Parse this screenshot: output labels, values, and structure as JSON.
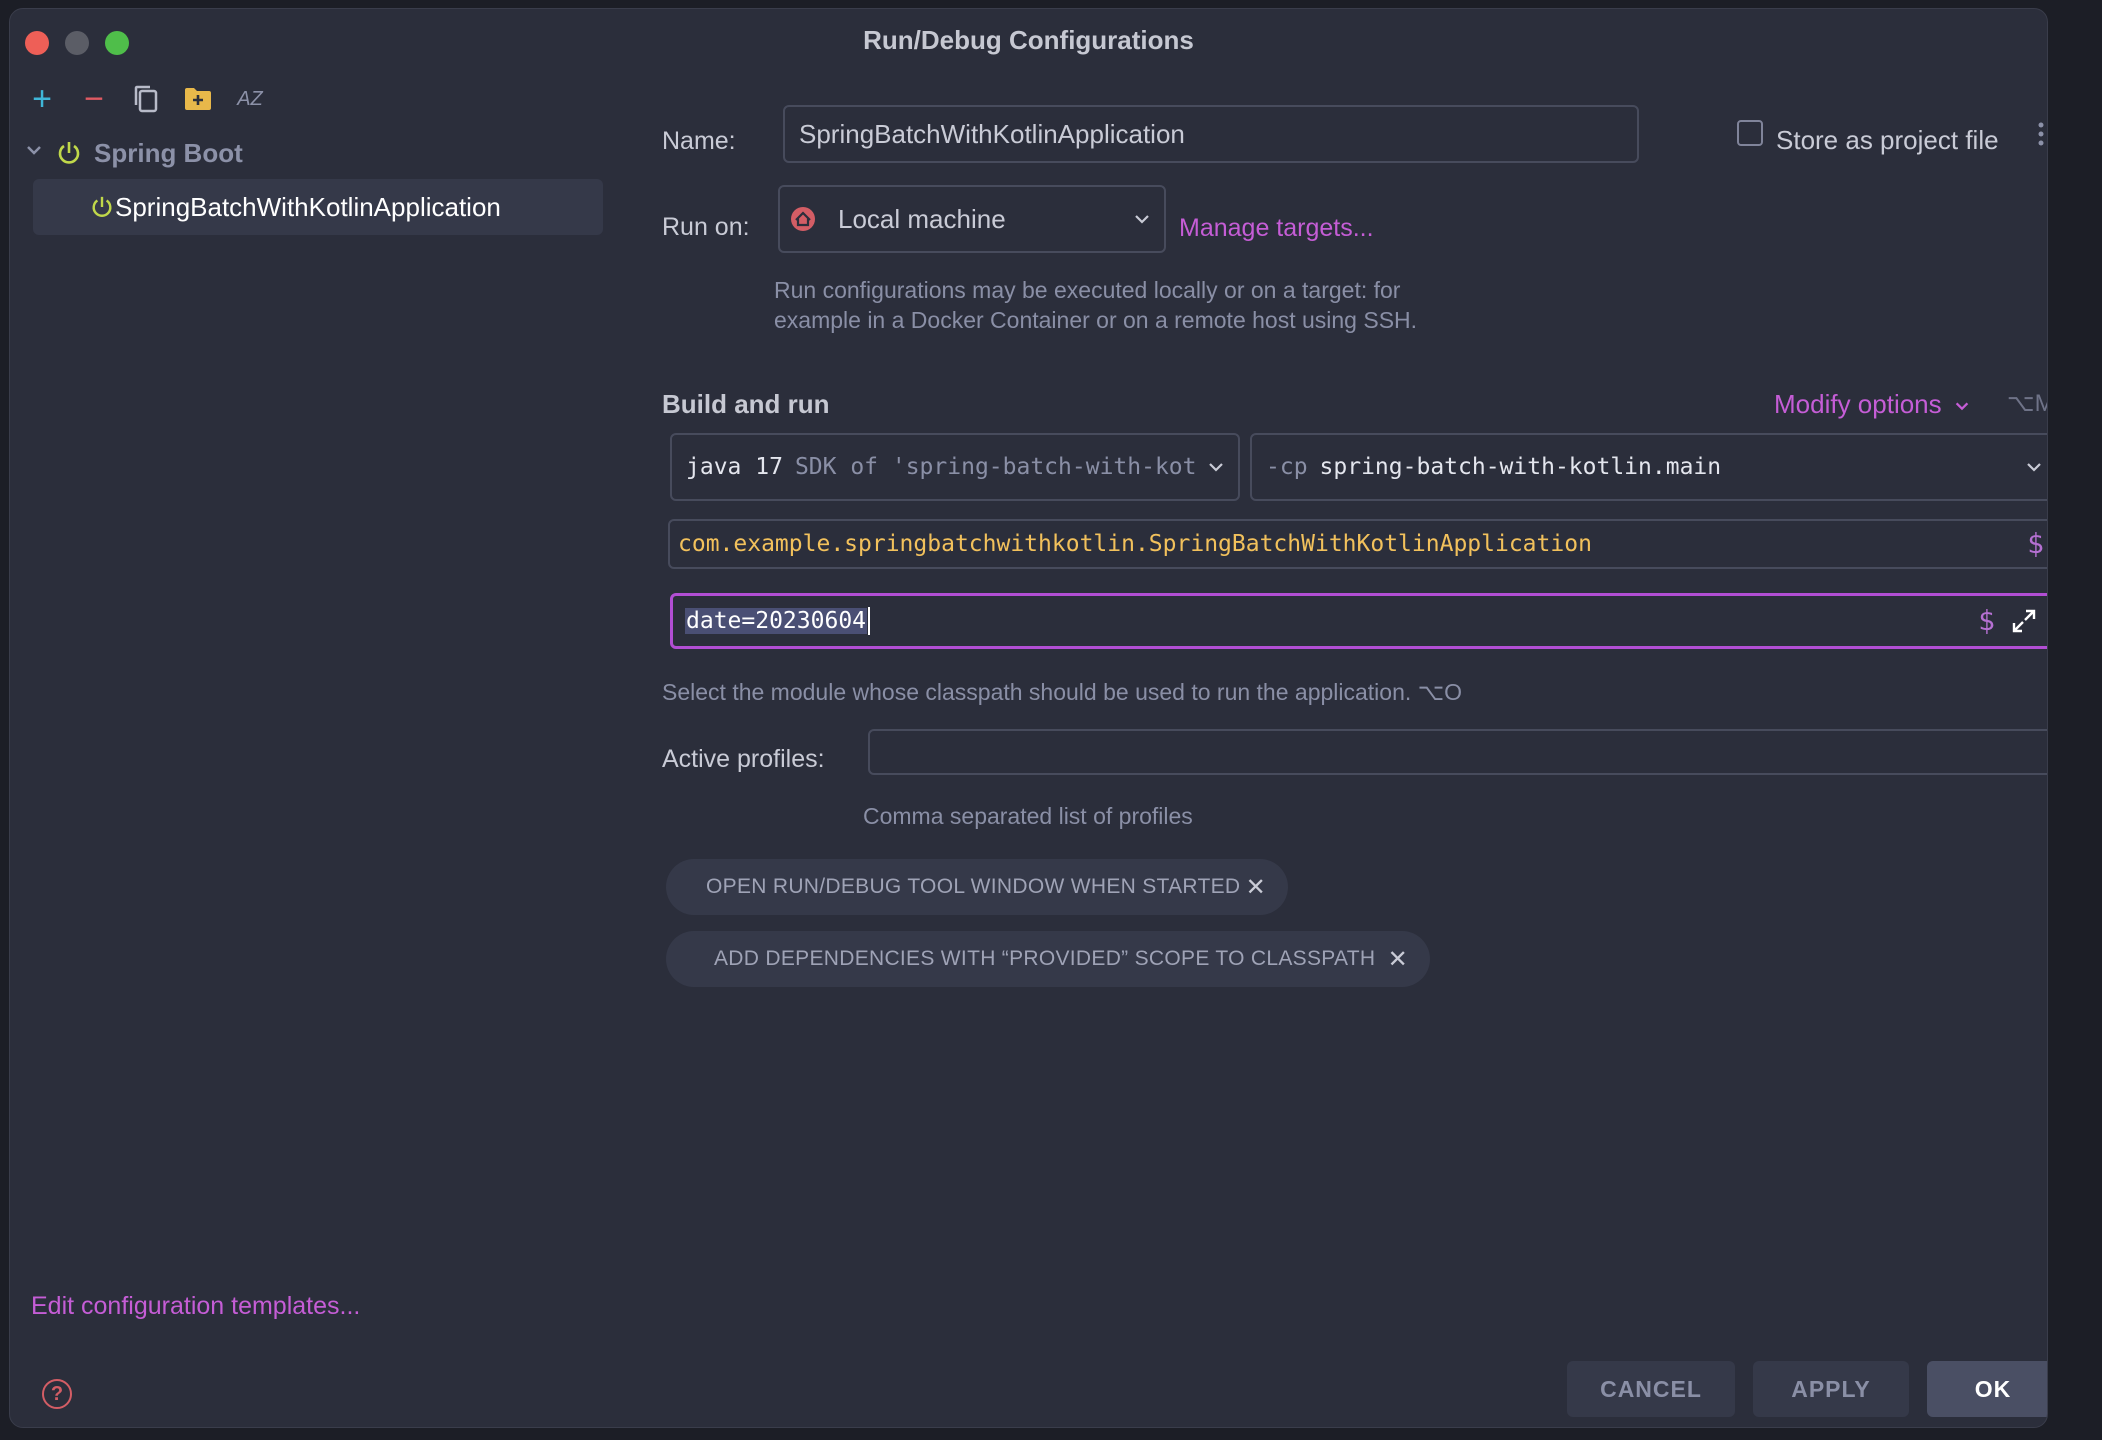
{
  "window": {
    "title": "Run/Debug Configurations"
  },
  "toolbar": {
    "add": "+",
    "remove": "−",
    "sort_label": "AZ"
  },
  "tree": {
    "group_label": "Spring Boot",
    "item_label": "SpringBatchWithKotlinApplication"
  },
  "sidebar": {
    "edit_templates": "Edit configuration templates..."
  },
  "form": {
    "name_label": "Name:",
    "name_value": "SpringBatchWithKotlinApplication",
    "store_label": "Store as project file",
    "run_on_label": "Run on:",
    "run_on_value": "Local machine",
    "manage_targets": "Manage targets...",
    "run_on_hint_1": "Run configurations may be executed locally or on a target: for",
    "run_on_hint_2": "example in a Docker Container or on a remote host using SSH.",
    "build_run_label": "Build and run",
    "modify_options": "Modify options",
    "modify_shortcut": "⌥M",
    "jdk_prefix": "java 17",
    "jdk_value": "SDK of 'spring-batch-with-kotlin",
    "cp_prefix": "-cp",
    "cp_value": "spring-batch-with-kotlin.main",
    "main_class": "com.example.springbatchwithkotlin.SpringBatchWithKotlinApplication",
    "program_args": "date=20230604",
    "module_hint": "Select the module whose classpath should be used to run the application. ⌥O",
    "profiles_label": "Active profiles:",
    "profiles_value": "",
    "profiles_hint": "Comma separated list of profiles",
    "dollar": "$"
  },
  "chips": [
    {
      "label": "OPEN RUN/DEBUG TOOL WINDOW WHEN STARTED"
    },
    {
      "label": "ADD DEPENDENCIES WITH “PROVIDED” SCOPE TO CLASSPATH"
    }
  ],
  "buttons": {
    "cancel": "CANCEL",
    "apply": "APPLY",
    "ok": "OK",
    "help": "?"
  },
  "colors": {
    "background": "#2b2e3b",
    "accent": "#c55dd6",
    "focus_border": "#b24ed4",
    "main_class_text": "#f2c15c",
    "power_icon": "#c0d84a"
  }
}
